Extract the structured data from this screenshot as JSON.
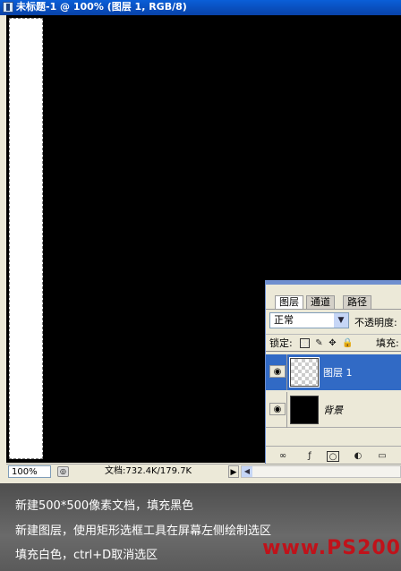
{
  "window": {
    "title": "未标题-1 @ 100% (图层 1, RGB/8)"
  },
  "statusbar": {
    "zoom": "100%",
    "doc_info": "文档:732.4K/179.7K",
    "arrow": "▶"
  },
  "layers_panel": {
    "tabs": [
      "图层",
      "通道",
      "路径"
    ],
    "blend_mode": "正常",
    "opacity_label": "不透明度:",
    "lock_label": "锁定:",
    "fill_label": "填充:",
    "layers": [
      {
        "name": "图层 1",
        "selected": true,
        "thumbnail": "transparent"
      },
      {
        "name": "背景",
        "selected": false,
        "thumbnail": "black"
      }
    ],
    "icons": {
      "eye": "eye-icon",
      "link": "link-icon",
      "style": "layer-style-icon",
      "mask": "layer-mask-icon",
      "adjust": "adjustment-layer-icon",
      "folder": "folder-icon"
    }
  },
  "caption": {
    "lines": [
      "新建500*500像素文档，填充黑色",
      "新建图层，使用矩形选框工具在屏幕左侧绘制选区",
      "填充白色，ctrl+D取消选区"
    ],
    "watermark": "www.PS200"
  },
  "colors": {
    "canvas": "#000000",
    "selection_fill": "#ffffff",
    "selected_layer": "#316ac5",
    "watermark": "#c0121a"
  }
}
